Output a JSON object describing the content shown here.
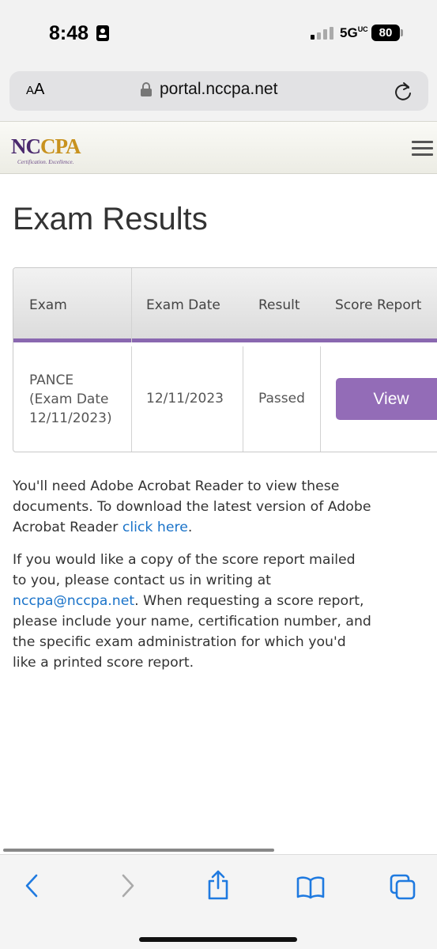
{
  "status_bar": {
    "time": "8:48",
    "network": "5G",
    "network_suffix": "UC",
    "battery": "80"
  },
  "browser": {
    "text_size_label_small": "A",
    "text_size_label_large": "A",
    "url": "portal.nccpa.net"
  },
  "site": {
    "logo_text_1": "NC",
    "logo_text_2": "C",
    "logo_text_3": "PA",
    "logo_tagline": "Certification. Excellence."
  },
  "page": {
    "title": "Exam Results"
  },
  "table": {
    "headers": [
      "Exam",
      "Exam Date",
      "Result",
      "Score Report"
    ],
    "rows": [
      {
        "exam_line1": "PANCE",
        "exam_line2": "(Exam Date",
        "exam_line3": "12/11/2023)",
        "exam_date": "12/11/2023",
        "result": "Passed",
        "score_report_button": "View"
      }
    ]
  },
  "info": {
    "para1_line1": "You'll need Adobe Acrobat Reader to view these",
    "para1_line2": "documents. To download the latest version of Adobe",
    "para1_line3_prefix": "Acrobat Reader ",
    "para1_link": "click here",
    "para1_line3_suffix": ".",
    "para2_line1": "If you would like a copy of the score report mailed",
    "para2_line2": "to you, please contact us in writing at",
    "para2_email": "nccpa@nccpa.net",
    "para2_line3_suffix": ". When requesting a score report,",
    "para2_line4": "please include your name, certification number, and",
    "para2_line5": "the specific exam administration for which you'd",
    "para2_line6": "like a printed score report."
  },
  "colors": {
    "accent_purple": "#936cb7",
    "link_blue": "#1a73c9",
    "ios_blue": "#1f7ae0"
  },
  "icons": [
    "focus-mode-icon",
    "cellular-signal-icon",
    "lock-icon",
    "reload-icon",
    "hamburger-menu-icon",
    "back-icon",
    "forward-icon",
    "share-icon",
    "bookmarks-icon",
    "tabs-icon"
  ]
}
